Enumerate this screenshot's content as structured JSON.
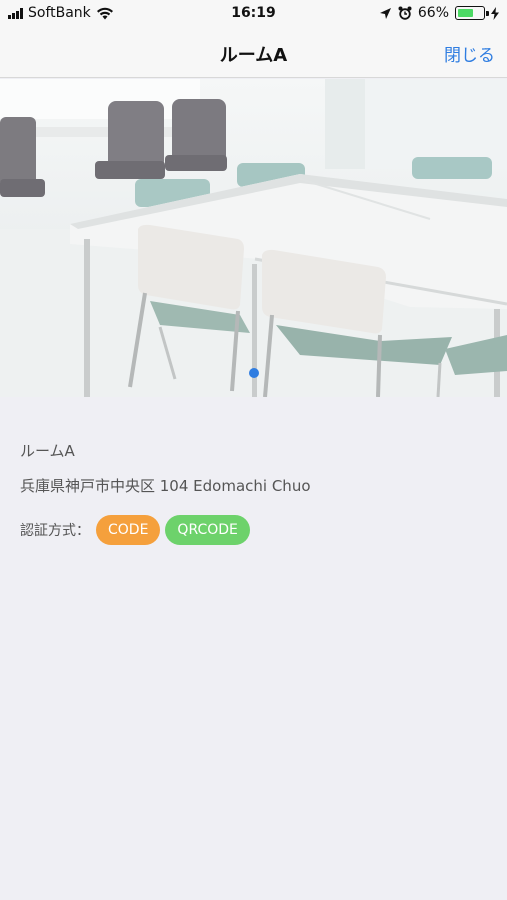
{
  "status_bar": {
    "carrier": "SoftBank",
    "time": "16:19",
    "battery_percent": "66%",
    "battery_level": 0.66
  },
  "nav": {
    "title": "ルームA",
    "close_label": "閉じる"
  },
  "room": {
    "name": "ルームA",
    "address": "兵庫県神戸市中央区 104 Edomachi Chuo",
    "auth_label": "認証方式：",
    "auth_methods": [
      {
        "label": "CODE",
        "color": "#f5a03c"
      },
      {
        "label": "QRCODE",
        "color": "#6dd26b"
      }
    ]
  },
  "carousel": {
    "pages": 1,
    "current": 1
  },
  "colors": {
    "accent": "#2f7de1",
    "background": "#efeff4"
  }
}
